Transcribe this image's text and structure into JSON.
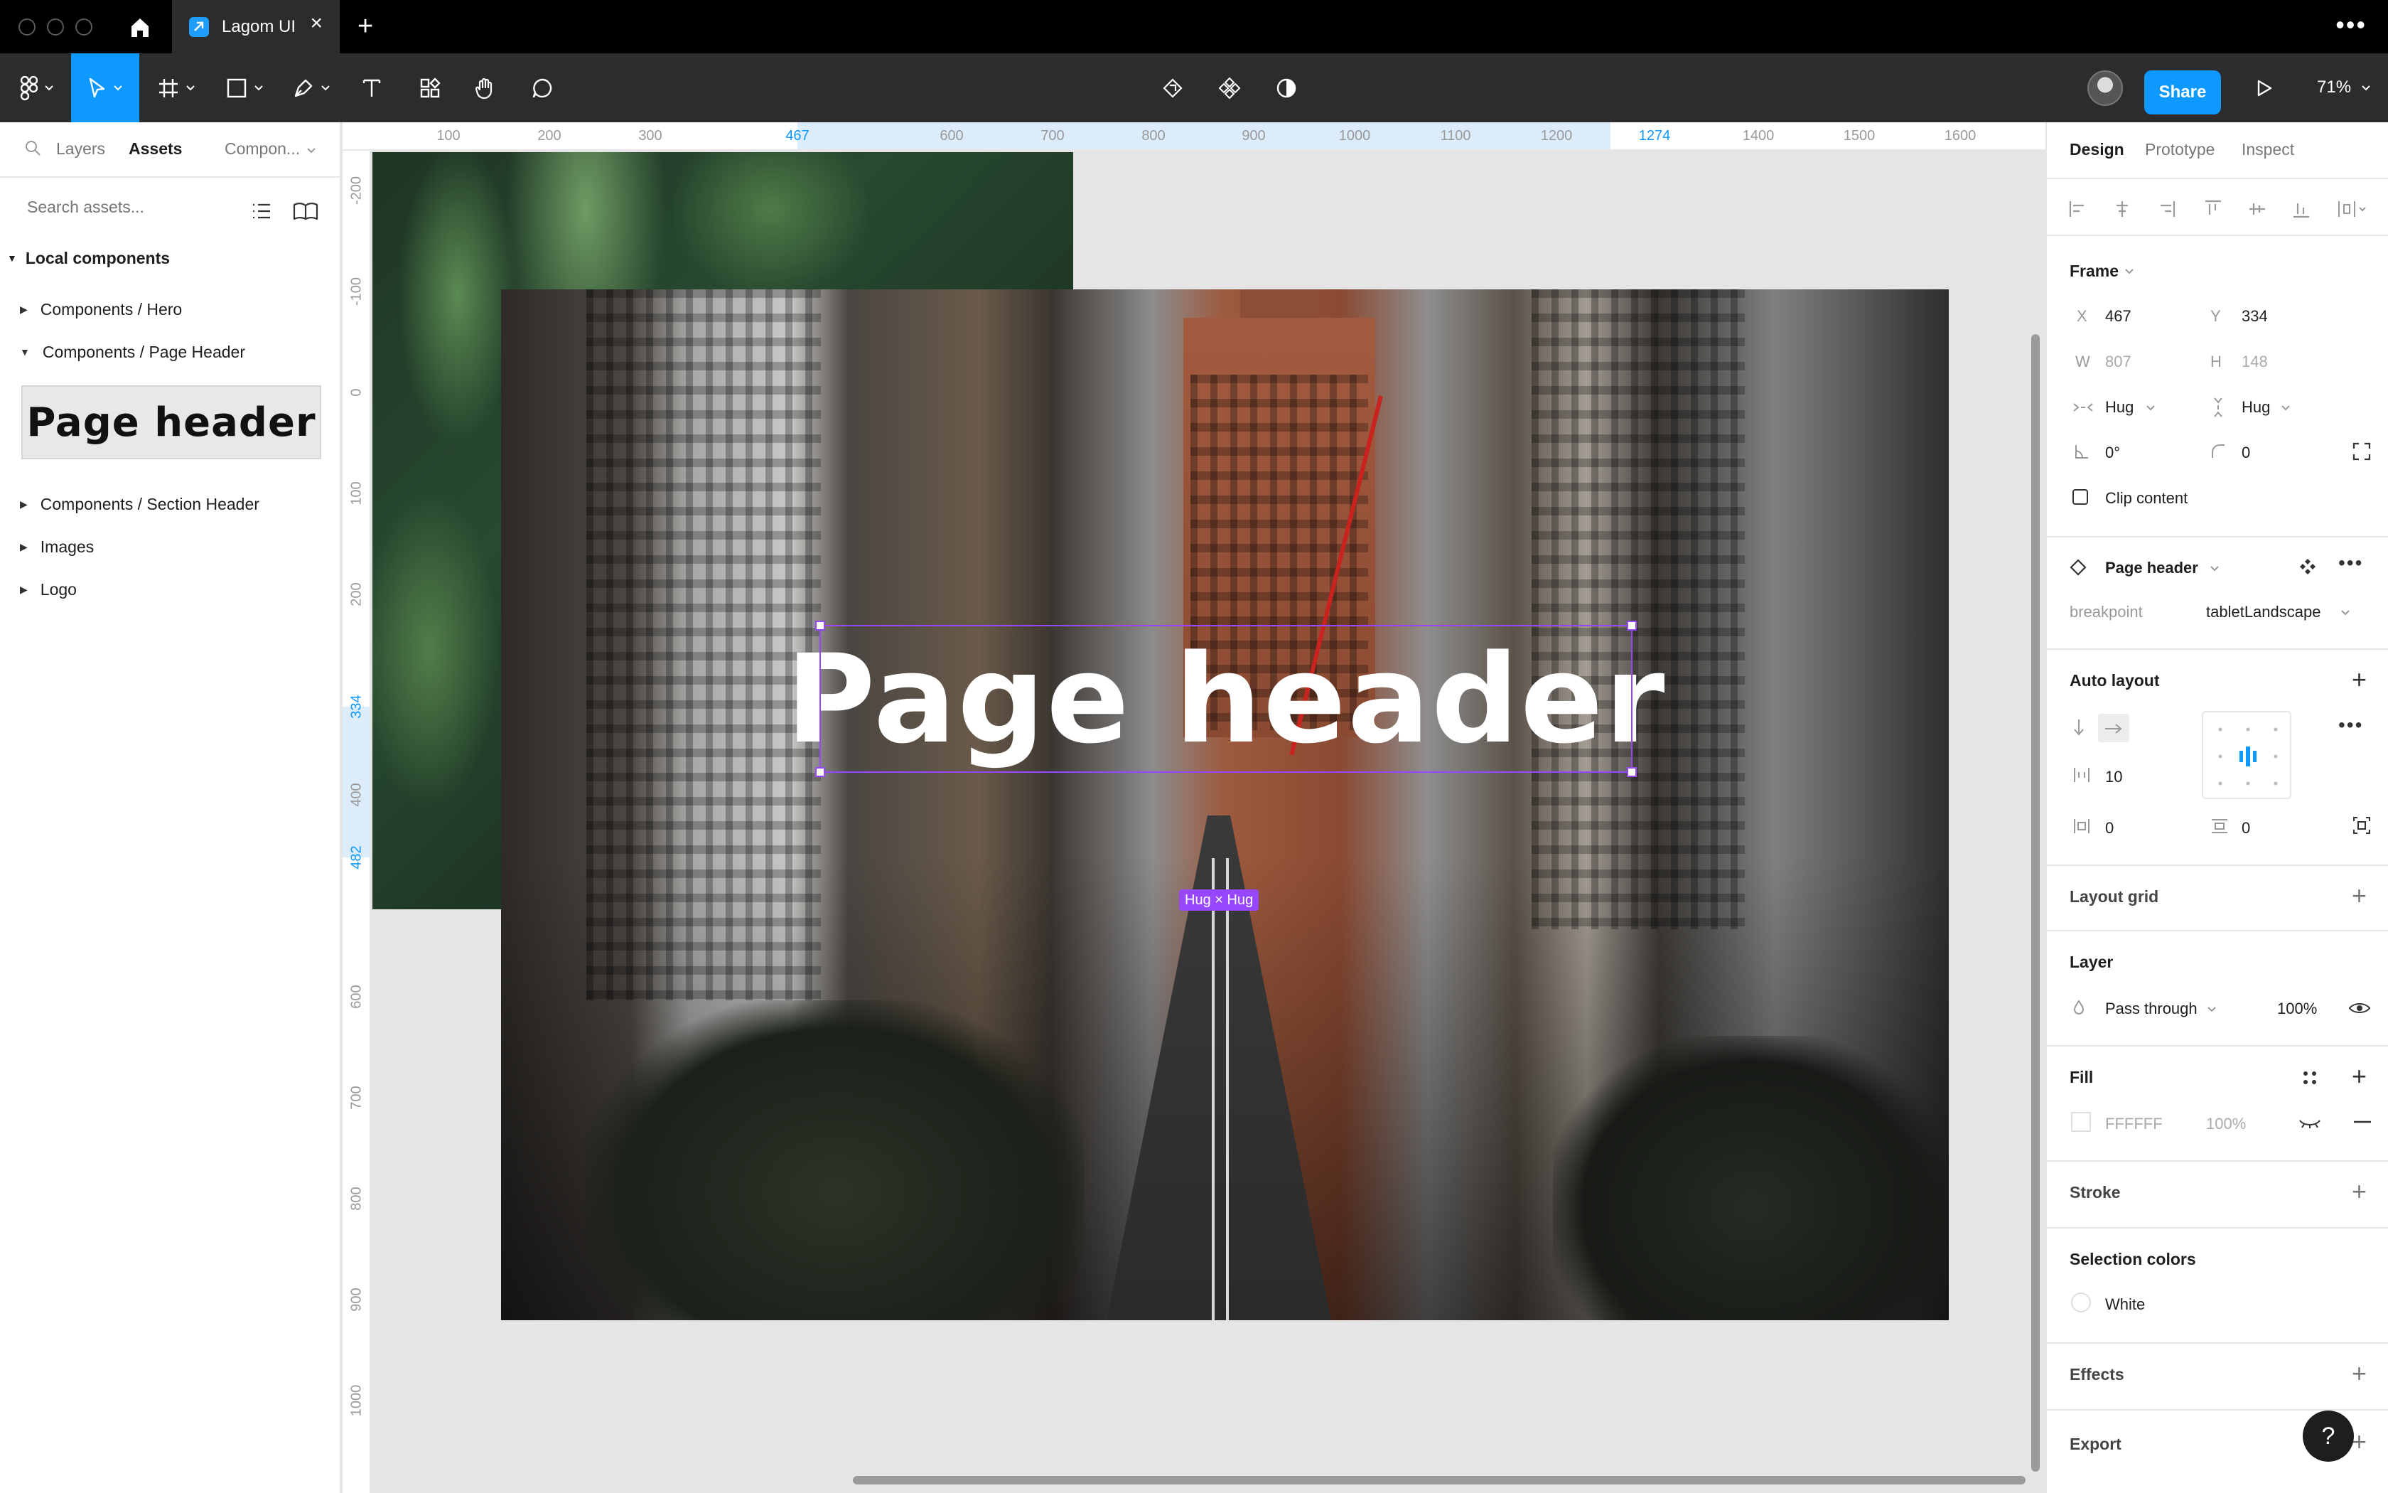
{
  "titlebar": {
    "tab_label": "Lagom UI"
  },
  "toolbar": {
    "share_label": "Share",
    "zoom_label": "71%"
  },
  "left_panel": {
    "tabs": [
      "Layers",
      "Assets",
      "Compon..."
    ],
    "search_placeholder": "Search assets...",
    "section_title": "Local components",
    "items": [
      {
        "label": "Components / Hero",
        "expanded": false
      },
      {
        "label": "Components / Page Header",
        "expanded": true
      },
      {
        "label": "Components / Section Header",
        "expanded": false
      },
      {
        "label": "Images",
        "expanded": false
      },
      {
        "label": "Logo",
        "expanded": false
      }
    ],
    "component_preview_text": "Page header"
  },
  "rulers": {
    "top": [
      "100",
      "200",
      "300",
      "467",
      "600",
      "700",
      "800",
      "900",
      "1000",
      "1100",
      "1200",
      "1274",
      "1400",
      "1500",
      "1600"
    ],
    "left": [
      "-200",
      "-100",
      "0",
      "100",
      "200",
      "334",
      "400",
      "482",
      "600",
      "700",
      "800",
      "900",
      "1000"
    ]
  },
  "canvas": {
    "header_text": "Page header",
    "hug_badge": "Hug × Hug"
  },
  "right_panel": {
    "tabs": [
      "Design",
      "Prototype",
      "Inspect"
    ],
    "frame": {
      "title": "Frame",
      "x_label": "X",
      "x_value": "467",
      "y_label": "Y",
      "y_value": "334",
      "w_label": "W",
      "w_value": "807",
      "h_label": "H",
      "h_value": "148",
      "hug_h": "Hug",
      "hug_v": "Hug",
      "rotation": "0°",
      "radius": "0",
      "clip_content": "Clip content"
    },
    "instance": {
      "name": "Page header",
      "prop_label": "breakpoint",
      "prop_value": "tabletLandscape"
    },
    "auto_layout": {
      "title": "Auto layout",
      "gap": "10",
      "padding_h": "0",
      "padding_v": "0"
    },
    "layout_grid": "Layout grid",
    "layer": {
      "title": "Layer",
      "blend": "Pass through",
      "opacity": "100%"
    },
    "fill": {
      "title": "Fill",
      "hex": "FFFFFF",
      "opacity": "100%"
    },
    "stroke": "Stroke",
    "selection_colors": {
      "title": "Selection colors",
      "color_name": "White"
    },
    "effects": "Effects",
    "export": "Export",
    "help": "?"
  },
  "colors": {
    "accent": "#0d99ff",
    "selection": "#9747ff",
    "toolbar_bg": "#2c2c2c"
  }
}
